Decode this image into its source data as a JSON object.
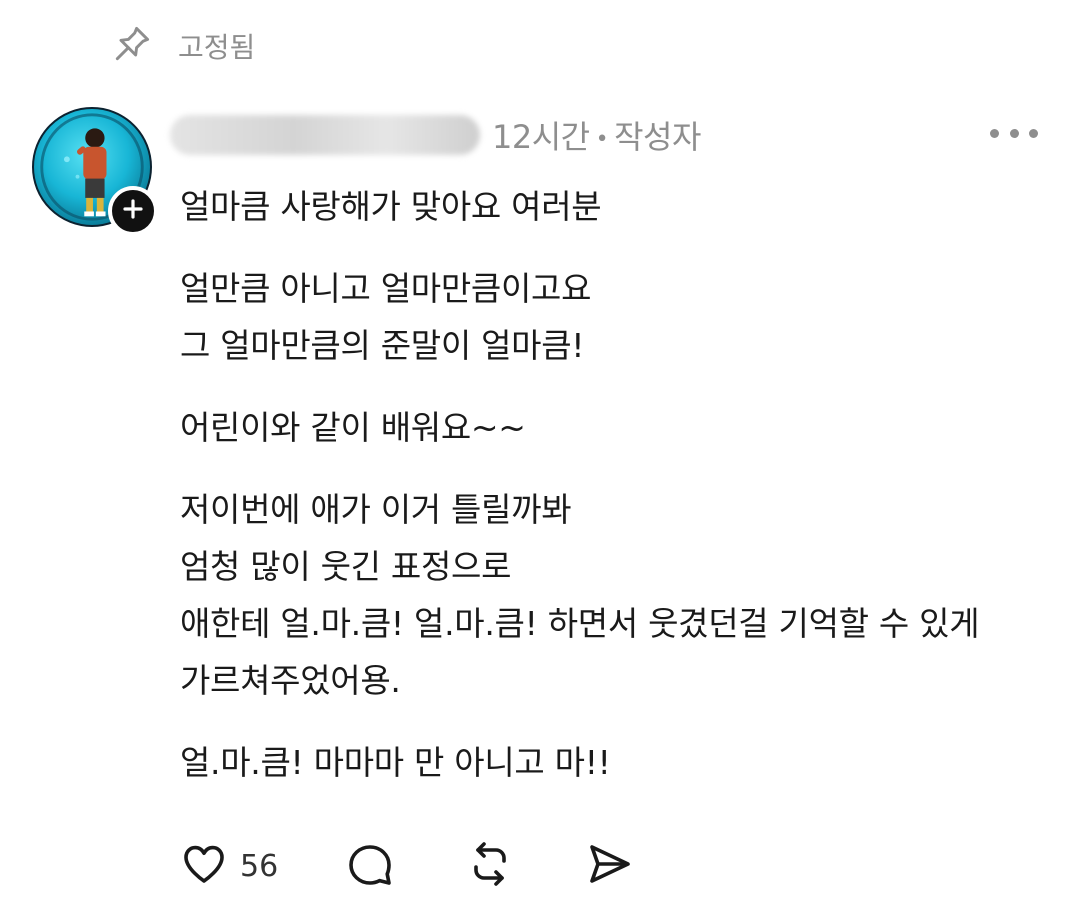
{
  "pinned": {
    "label": "고정됨"
  },
  "post": {
    "meta_time": "12시간",
    "meta_separator": "•",
    "meta_author_tag": "작성자",
    "paragraphs": [
      [
        "얼마큼 사랑해가 맞아요 여러분"
      ],
      [
        "얼만큼 아니고 얼마만큼이고요",
        "그 얼마만큼의 준말이 얼마큼!"
      ],
      [
        "어린이와 같이 배워요~~"
      ],
      [
        "저이번에 애가 이거 틀릴까봐",
        "엄청 많이 웃긴 표정으로",
        "애한테 얼.마.큼! 얼.마.큼! 하면서 웃겼던걸 기억할 수 있게",
        "가르쳐주었어용."
      ],
      [
        "얼.마.큼! 마마마 만 아니고 마!!"
      ]
    ]
  },
  "actions": {
    "like_count": "56"
  },
  "icons": {
    "pin": "pin-icon",
    "follow": "plus-icon",
    "more": "more-horizontal-icon",
    "like": "heart-icon",
    "reply": "comment-icon",
    "repost": "repost-icon",
    "share": "send-icon"
  },
  "colors": {
    "muted": "#8e8e8e",
    "text": "#1a1a1a",
    "background": "#ffffff"
  }
}
